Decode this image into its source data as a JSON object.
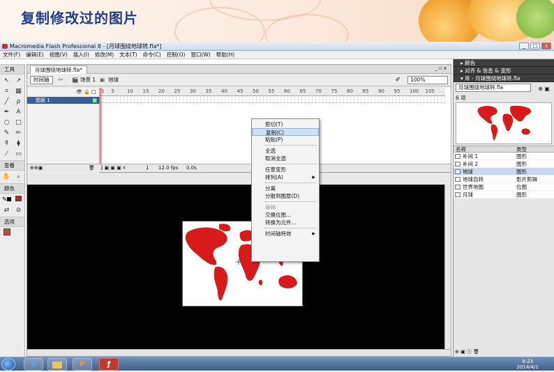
{
  "slide": {
    "title": "复制修改过的图片"
  },
  "window": {
    "title": "Macromedia Flash Professional 8 - [月球围绕地球转.fla*]",
    "min": "_",
    "max": "□",
    "close": "x"
  },
  "menubar": {
    "items": [
      "文件(F)",
      "编辑(E)",
      "视图(V)",
      "插入(I)",
      "修改(M)",
      "文本(T)",
      "命令(C)",
      "控制(O)",
      "窗口(W)",
      "帮助(H)"
    ]
  },
  "doc": {
    "tab": "月球围绕地球转.fla*",
    "doc_controls": "_ ▫ x",
    "timeline_btn": "时间轴",
    "scene": "场景 1",
    "symbol": "地球",
    "zoom": "100%",
    "layer": "图层 1",
    "ruler_ticks": [
      "1",
      "5",
      "10",
      "15",
      "20",
      "25",
      "30",
      "35",
      "40",
      "45",
      "50",
      "55",
      "60",
      "65",
      "70",
      "75",
      "80",
      "85",
      "90",
      "95",
      "100",
      "105"
    ],
    "footer": {
      "frame": "1",
      "fps": "12.0 fps",
      "time": "0.0s"
    }
  },
  "context_menu": {
    "items": [
      {
        "label": "剪切(T)",
        "state": "normal"
      },
      {
        "label": "复制(C)",
        "state": "highlight"
      },
      {
        "label": "粘贴(P)",
        "state": "normal"
      },
      {
        "sep": true
      },
      {
        "label": "全选",
        "state": "normal"
      },
      {
        "label": "取消全选",
        "state": "normal"
      },
      {
        "sep": true
      },
      {
        "label": "任意变形",
        "state": "normal"
      },
      {
        "label": "排列(A)",
        "state": "normal",
        "sub": true
      },
      {
        "sep": true
      },
      {
        "label": "分离",
        "state": "normal"
      },
      {
        "label": "分散到图层(D)",
        "state": "normal"
      },
      {
        "sep": true
      },
      {
        "label": "编辑",
        "state": "disabled"
      },
      {
        "label": "交换位图...",
        "state": "normal"
      },
      {
        "label": "转换为元件...",
        "state": "normal"
      },
      {
        "sep": true
      },
      {
        "label": "时间轴特效",
        "state": "normal",
        "sub": true
      }
    ]
  },
  "tools": {
    "header": "工具",
    "view_label": "查看",
    "color_label": "颜色",
    "options_label": "选项",
    "icons": [
      "selection-icon",
      "subselect-icon",
      "free-transform-icon",
      "gradient-transform-icon",
      "line-icon",
      "lasso-icon",
      "pen-icon",
      "text-icon",
      "oval-icon",
      "rectangle-icon",
      "pencil-icon",
      "brush-icon",
      "ink-bottle-icon",
      "paint-bucket-icon",
      "eyedropper-icon",
      "eraser-icon"
    ],
    "glyphs": [
      "↖",
      "↗",
      "⌗",
      "▦",
      "╱",
      "ρ",
      "✒",
      "A",
      "○",
      "□",
      "✎",
      "✏",
      "⚱",
      "⧫",
      "⁄",
      "▭"
    ]
  },
  "panels": {
    "color": "颜色",
    "align": "对齐 & 信息 & 变形",
    "library": "库 - 月球围绕地球转.fla",
    "library_select": "月球围绕地球转.fla",
    "count": "6 项",
    "col_name": "名称",
    "col_type": "类型",
    "items": [
      {
        "name": "补间 1",
        "type": "图形"
      },
      {
        "name": "补间 2",
        "type": "图形"
      },
      {
        "name": "地球",
        "type": "图形",
        "selected": true
      },
      {
        "name": "地球自转",
        "type": "影片剪辑"
      },
      {
        "name": "世界地图",
        "type": "位图"
      },
      {
        "name": "月球",
        "type": "图形"
      }
    ]
  },
  "taskbar": {
    "time": "8:23",
    "date": "2014/4/1",
    "app_p": "P",
    "app_f": "ƒ",
    "app_e": "e"
  },
  "colors": {
    "map_red": "#d81a1a",
    "stage_bg": "#000000",
    "highlight": "#cfe0f6",
    "title_blue": "#1f3d8a"
  }
}
